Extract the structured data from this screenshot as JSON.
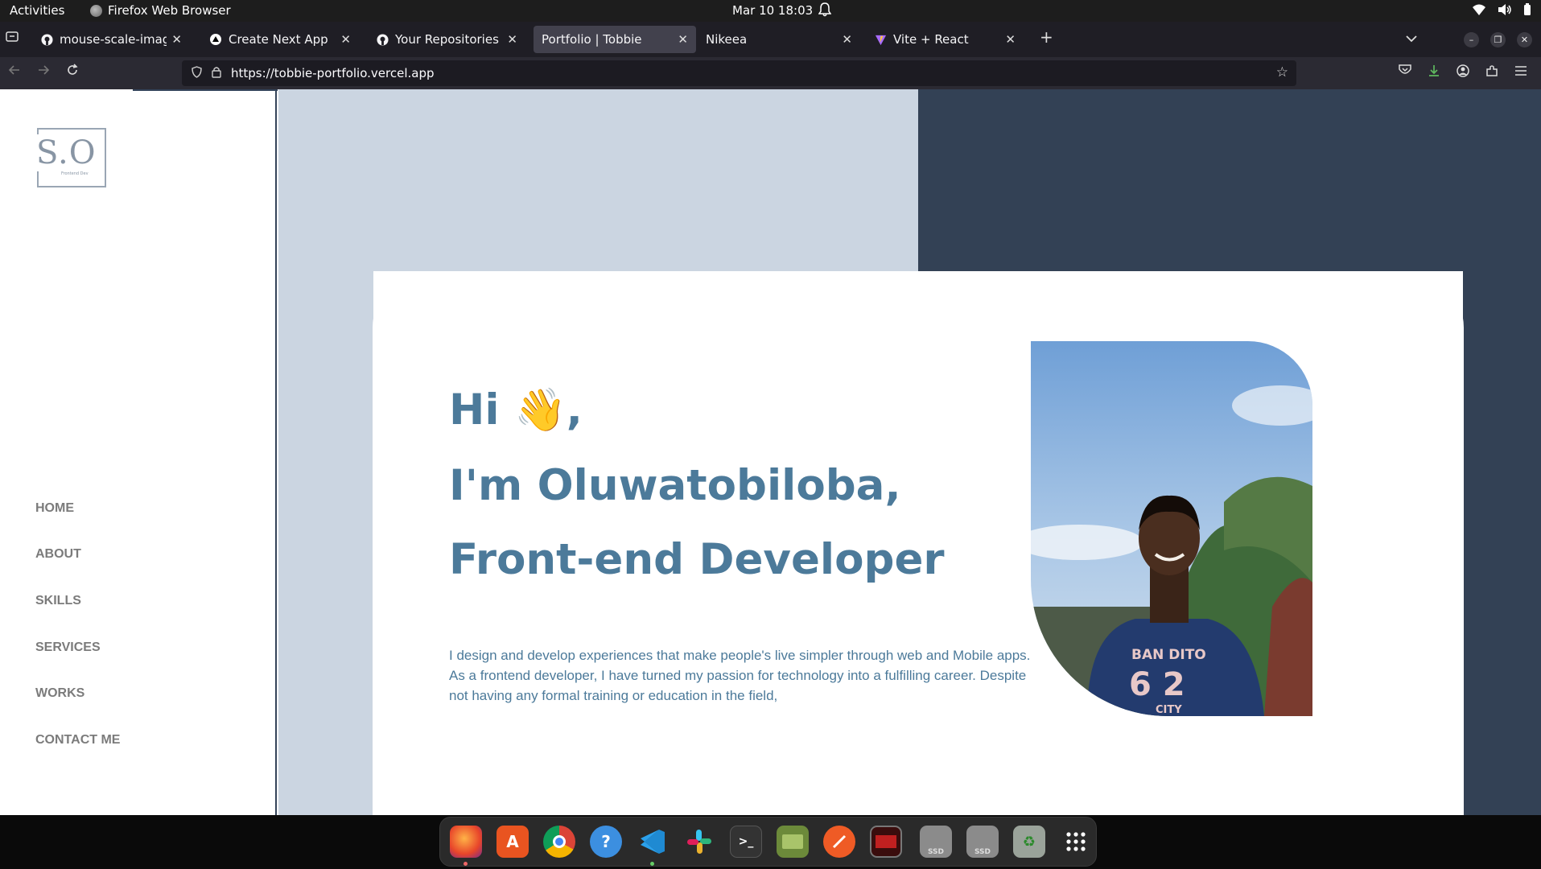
{
  "system_bar": {
    "activities": "Activities",
    "app_name": "Firefox Web Browser",
    "clock": "Mar 10  18:03"
  },
  "tabs": [
    {
      "title": "mouse-scale-image-ga",
      "favicon": "github-icon",
      "active": false
    },
    {
      "title": "Create Next App",
      "favicon": "nextjs-triangle-icon",
      "active": false
    },
    {
      "title": "Your Repositories",
      "favicon": "github-icon",
      "active": false
    },
    {
      "title": "Portfolio | Tobbie",
      "favicon": "none",
      "active": true
    },
    {
      "title": "Nikeea",
      "favicon": "none",
      "active": false
    },
    {
      "title": "Vite + React",
      "favicon": "vite-icon",
      "active": false
    }
  ],
  "address_bar": {
    "url": "https://tobbie-portfolio.vercel.app"
  },
  "sidebar": {
    "logo_monogram": "S.O",
    "logo_tagline": "Frontend Dev",
    "menu": [
      "HOME",
      "ABOUT",
      "SKILLS",
      "SERVICES",
      "WORKS",
      "CONTACT ME"
    ]
  },
  "hero": {
    "greeting": "Hi",
    "greeting_emoji": "👋",
    "greeting_suffix": ",",
    "intro_line": "I'm Oluwatobiloba,",
    "role_line": "Front-end Developer",
    "bio": "I design and develop experiences that make people's live simpler through web and Mobile apps. As a frontend developer, I have turned my passion for technology into a fulfilling career. Despite not having any formal training or education in the field,",
    "photo_shirt_text_1": "BAN DITO",
    "photo_shirt_text_2": "6 2",
    "photo_shirt_text_3": "CITY"
  },
  "dock": {
    "apps": [
      "firefox-icon",
      "app-center-icon",
      "chrome-icon",
      "help-icon",
      "vscode-icon",
      "slack-icon",
      "terminal-icon",
      "files-icon",
      "postman-icon",
      "screen-icon",
      "ssd-drive-icon",
      "ssd-drive-icon",
      "trash-icon",
      "show-apps-icon"
    ],
    "ssd_label": "SSD"
  },
  "colors": {
    "accent_text": "#4c7a9a",
    "light_bg": "#cbd5e1",
    "dark_bg": "#334155",
    "menu_text": "#7b7b7b"
  }
}
